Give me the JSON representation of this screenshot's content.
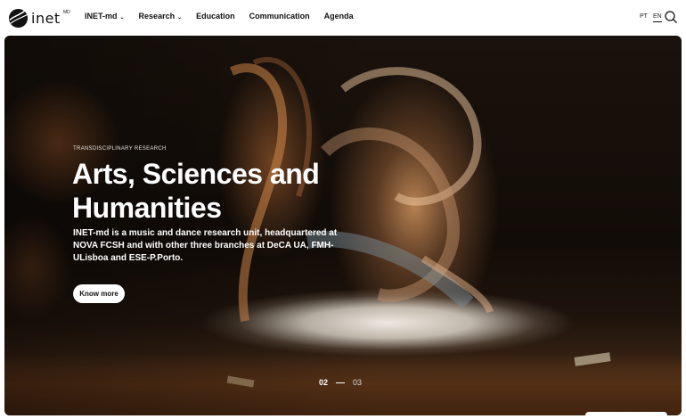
{
  "header": {
    "logo_text": "inet",
    "logo_sup": "MD",
    "nav": [
      {
        "label": "INET-md",
        "dropdown": true
      },
      {
        "label": "Research",
        "dropdown": true
      },
      {
        "label": "Education",
        "dropdown": false
      },
      {
        "label": "Communication",
        "dropdown": false
      },
      {
        "label": "Agenda",
        "dropdown": false
      }
    ],
    "languages": [
      "PT",
      "EN"
    ],
    "active_language": "EN",
    "search_icon": "search-icon"
  },
  "hero": {
    "eyebrow": "TRANSDISCIPLINARY RESEARCH",
    "title": "Arts, Sciences and Humanities",
    "description": "INET-md is a music and dance research unit, headquartered at NOVA FCSH and with other three branches at DeCA UA, FMH-ULisboa and ESE-P.Porto.",
    "cta_label": "Know more",
    "pager": {
      "current": "02",
      "next": "03"
    }
  },
  "colors": {
    "header_bg": "#ffffff",
    "text_dark": "#111111",
    "hero_text": "#ffffff",
    "cta_bg": "#ffffff"
  }
}
